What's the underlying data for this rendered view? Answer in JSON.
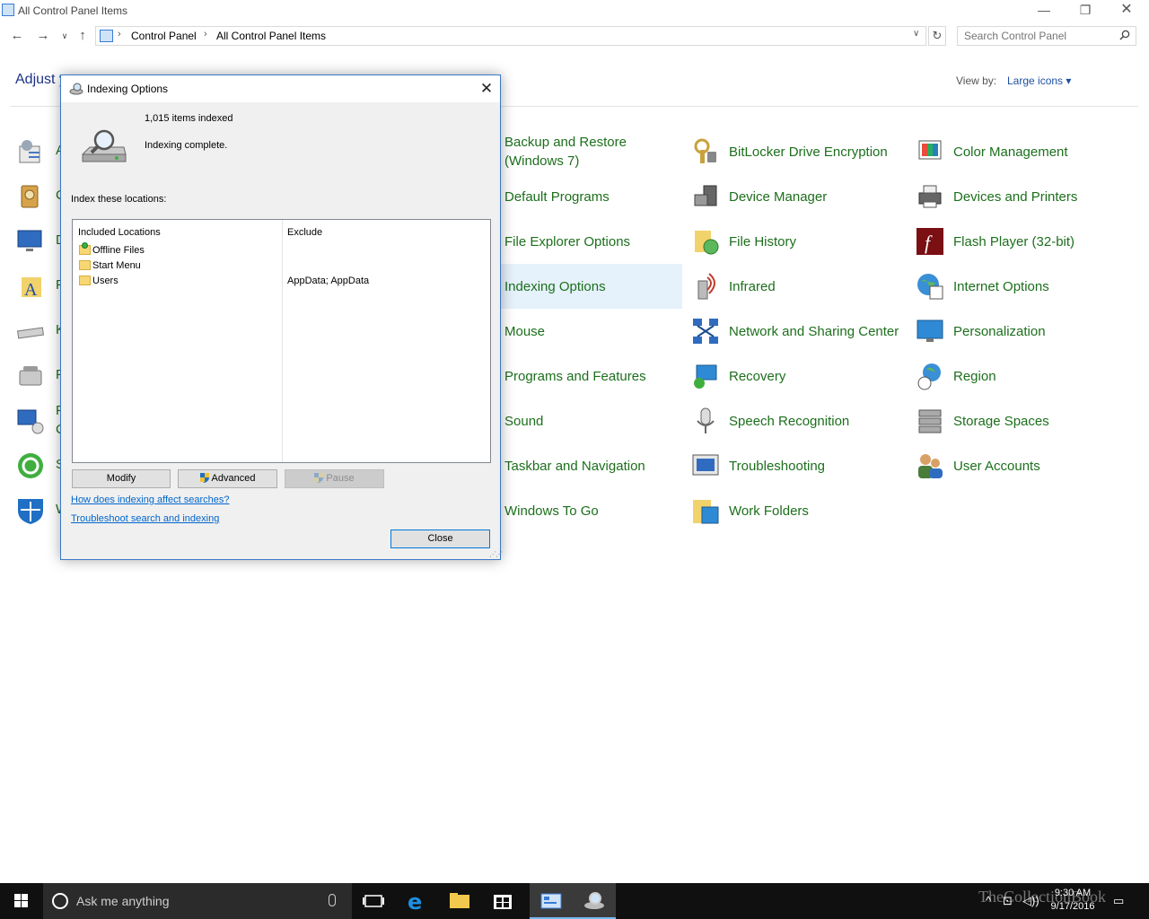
{
  "window": {
    "title": "All Control Panel Items",
    "minimize": "—",
    "restore": "❐",
    "close": "✕"
  },
  "nav": {
    "back": "←",
    "forward": "→",
    "recent": "∨",
    "up": "↑",
    "breadcrumb": [
      "Control Panel",
      "All Control Panel Items"
    ],
    "crumb_separator": "›",
    "refresh": "↻",
    "address_dropdown": "∨",
    "search_placeholder": "Search Control Panel"
  },
  "header": {
    "adjust_visible": "Adjust y",
    "view_by_label": "View by:",
    "view_by_value": "Large icons ▾"
  },
  "left_column_visible": [
    "A",
    "C",
    "D",
    "F",
    "K",
    "P",
    "F",
    "S",
    "W"
  ],
  "left_column_second_line": "C",
  "items": {
    "col3": [
      "Backup and Restore (Windows 7)",
      "Default Programs",
      "File Explorer Options",
      "Indexing Options",
      "Mouse",
      "Programs and Features",
      "Sound",
      "Taskbar and Navigation",
      "Windows To Go"
    ],
    "col4": [
      "BitLocker Drive Encryption",
      "Device Manager",
      "File History",
      "Infrared",
      "Network and Sharing Center",
      "Recovery",
      "Speech Recognition",
      "Troubleshooting",
      "Work Folders"
    ],
    "col5": [
      "Color Management",
      "Devices and Printers",
      "Flash Player (32-bit)",
      "Internet Options",
      "Personalization",
      "Region",
      "Storage Spaces",
      "User Accounts"
    ]
  },
  "selected_item": "Indexing Options",
  "dialog": {
    "title": "Indexing Options",
    "close_glyph": "✕",
    "items_indexed": "1,015 items indexed",
    "status": "Indexing complete.",
    "index_label": "Index these locations:",
    "col_included": "Included Locations",
    "col_exclude": "Exclude",
    "locations": [
      {
        "name": "Offline Files",
        "exclude": ""
      },
      {
        "name": "Start Menu",
        "exclude": ""
      },
      {
        "name": "Users",
        "exclude": "AppData; AppData"
      }
    ],
    "btn_modify": "Modify",
    "btn_advanced": "Advanced",
    "btn_pause": "Pause",
    "link_how": "How does indexing affect searches?",
    "link_troubleshoot": "Troubleshoot search and indexing",
    "btn_close": "Close"
  },
  "taskbar": {
    "search_placeholder": "Ask me anything",
    "time": "9:30 AM",
    "date": "9/17/2016",
    "watermark": "TheCollectionBook",
    "tray_up": "^",
    "tray_network": "⊡",
    "tray_volume": "◁))",
    "tray_notifications": "▭"
  },
  "colors": {
    "accent": "#0078d7",
    "item_text": "#1c6f1c",
    "link": "#0066cc",
    "selected_bg": "#e5f1fb",
    "taskbar": "#101010"
  }
}
